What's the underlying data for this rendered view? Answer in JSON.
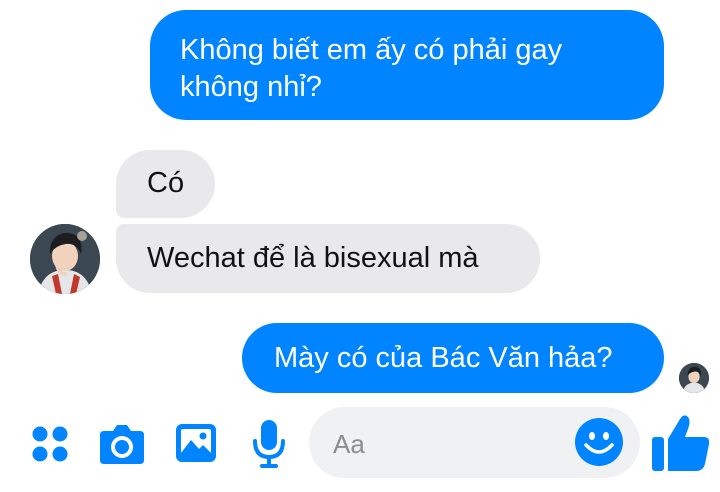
{
  "conversation": {
    "messages": [
      {
        "direction": "outgoing",
        "lines": [
          "Không biết em ấy có phải gay",
          "không nhỉ?"
        ]
      },
      {
        "direction": "incoming",
        "text": "Có"
      },
      {
        "direction": "incoming",
        "text": "Wechat để là bisexual mà"
      },
      {
        "direction": "outgoing",
        "text": "Mày có của Bác Văn hảa?"
      }
    ]
  },
  "composer": {
    "placeholder": "Aa"
  },
  "toolbar": {
    "icons": [
      "apps-icon",
      "camera-icon",
      "photo-icon",
      "mic-icon",
      "emoji-icon",
      "like-icon"
    ]
  },
  "colors": {
    "accent": "#0084ff",
    "incoming_bubble": "#e9e9eb",
    "composer_bg": "#f0f1f3"
  }
}
